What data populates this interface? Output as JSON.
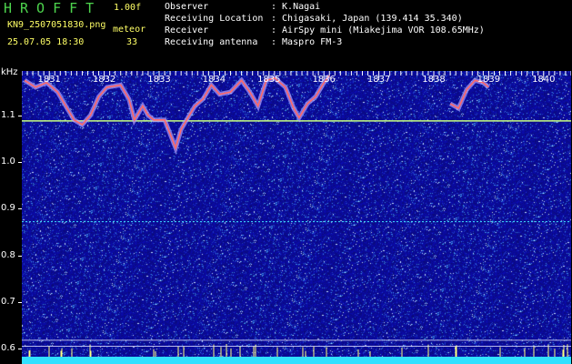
{
  "header": {
    "app_title": "HROFFT",
    "version": "1.00f",
    "filename": "KN9_2507051830.png",
    "mode": "meteor",
    "datetime": "25.07.05 18:30",
    "counter": "33"
  },
  "info": [
    {
      "label": "Observer",
      "value": ": K.Nagai"
    },
    {
      "label": "Receiving Location",
      "value": ": Chigasaki, Japan (139.414 35.340)"
    },
    {
      "label": "Receiver",
      "value": ": AirSpy mini (Miakejima VOR 108.65MHz)"
    },
    {
      "label": "Receiving antenna",
      "value": ": Maspro FM-3"
    }
  ],
  "colors": {
    "background": "#000000",
    "noise_base": "#1a1aa0",
    "carrier_line": "#c8ff80",
    "trace_core": "#ff6a6a",
    "trace_halo": "#b0a0ff",
    "grid_line": "#e0e0ff",
    "header_green": "#4dd44d",
    "header_yellow": "#ffff66",
    "bottom_band": "#30e0ff"
  },
  "chart_data": {
    "type": "heatmap",
    "xlabel": "",
    "ylabel": "kHz",
    "unit_label": "kHz",
    "x_tick_labels": [
      "1831",
      "1832",
      "1833",
      "1834",
      "1835",
      "1836",
      "1837",
      "1838",
      "1839",
      "1840"
    ],
    "x_range": [
      1830.5,
      1840.5
    ],
    "y_tick_labels": [
      "1.1",
      "1.0",
      "0.9",
      "0.8",
      "0.7",
      "0.6"
    ],
    "y_ticks": [
      1.1,
      1.0,
      0.9,
      0.8,
      0.7,
      0.6
    ],
    "y_range": [
      0.567,
      1.195
    ],
    "carrier_lines_khz": [
      1.088,
      0.872
    ],
    "reference_lines_khz": [
      0.618,
      0.605
    ],
    "trace": [
      {
        "t": 1830.55,
        "f": 1.175
      },
      {
        "t": 1830.75,
        "f": 1.16
      },
      {
        "t": 1830.95,
        "f": 1.17
      },
      {
        "t": 1831.15,
        "f": 1.15
      },
      {
        "t": 1831.3,
        "f": 1.12
      },
      {
        "t": 1831.45,
        "f": 1.09
      },
      {
        "t": 1831.6,
        "f": 1.08
      },
      {
        "t": 1831.75,
        "f": 1.1
      },
      {
        "t": 1831.9,
        "f": 1.14
      },
      {
        "t": 1832.05,
        "f": 1.16
      },
      {
        "t": 1832.3,
        "f": 1.165
      },
      {
        "t": 1832.45,
        "f": 1.135
      },
      {
        "t": 1832.55,
        "f": 1.09
      },
      {
        "t": 1832.7,
        "f": 1.12
      },
      {
        "t": 1832.8,
        "f": 1.1
      },
      {
        "t": 1832.9,
        "f": 1.09
      },
      {
        "t": 1833.1,
        "f": 1.09
      },
      {
        "t": 1833.2,
        "f": 1.06
      },
      {
        "t": 1833.3,
        "f": 1.03
      },
      {
        "t": 1833.4,
        "f": 1.07
      },
      {
        "t": 1833.5,
        "f": 1.09
      },
      {
        "t": 1833.65,
        "f": 1.12
      },
      {
        "t": 1833.8,
        "f": 1.135
      },
      {
        "t": 1833.95,
        "f": 1.165
      },
      {
        "t": 1834.1,
        "f": 1.145
      },
      {
        "t": 1834.3,
        "f": 1.15
      },
      {
        "t": 1834.5,
        "f": 1.175
      },
      {
        "t": 1834.65,
        "f": 1.15
      },
      {
        "t": 1834.8,
        "f": 1.12
      },
      {
        "t": 1834.95,
        "f": 1.175
      },
      {
        "t": 1835.1,
        "f": 1.18
      },
      {
        "t": 1835.3,
        "f": 1.16
      },
      {
        "t": 1835.45,
        "f": 1.115
      },
      {
        "t": 1835.55,
        "f": 1.095
      },
      {
        "t": 1835.7,
        "f": 1.125
      },
      {
        "t": 1835.85,
        "f": 1.14
      },
      {
        "t": 1836.0,
        "f": 1.17
      },
      {
        "t": 1836.1,
        "f": 1.185
      }
    ],
    "trace2": [
      {
        "t": 1838.3,
        "f": 1.125
      },
      {
        "t": 1838.45,
        "f": 1.115
      },
      {
        "t": 1838.6,
        "f": 1.155
      },
      {
        "t": 1838.75,
        "f": 1.175
      },
      {
        "t": 1838.9,
        "f": 1.17
      },
      {
        "t": 1839.0,
        "f": 1.16
      }
    ],
    "legend": "none",
    "grid": false
  }
}
